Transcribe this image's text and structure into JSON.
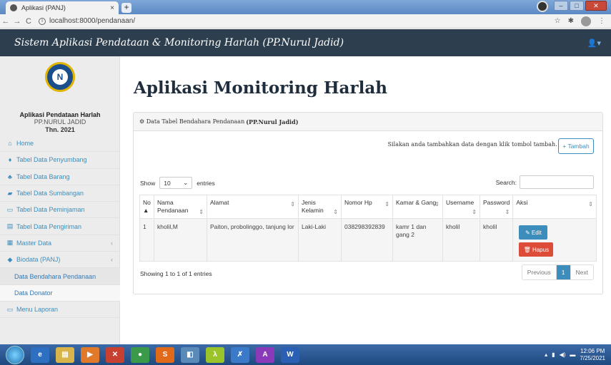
{
  "browser": {
    "tab_title": "Aplikasi (PANJ)",
    "tab_close": "×",
    "new_tab": "+",
    "url": "localhost:8000/pendanaan/"
  },
  "app": {
    "title": "Sistem Aplikasi Pendataan & Monitoring Harlah (PP.Nurul Jadid)"
  },
  "sidebar": {
    "brand_line1": "Aplikasi Pendataan Harlah",
    "brand_line2": "PP.NURUL JADID",
    "brand_line3": "Thn. 2021",
    "items": [
      {
        "label": "Home",
        "icon": "home-icon",
        "glyph": "⌂"
      },
      {
        "label": "Tabel Data Penyumbang",
        "icon": "user-icon",
        "glyph": "♦"
      },
      {
        "label": "Tabel Data Barang",
        "icon": "cubes-icon",
        "glyph": "♣"
      },
      {
        "label": "Tabel Data Sumbangan",
        "icon": "book-icon",
        "glyph": "▰"
      },
      {
        "label": "Tabel Data Peminjaman",
        "icon": "laptop-icon",
        "glyph": "▭"
      },
      {
        "label": "Tabel Data Pengiriman",
        "icon": "list-icon",
        "glyph": "▤"
      },
      {
        "label": "Master Data",
        "icon": "table-icon",
        "glyph": "▦"
      },
      {
        "label": "Biodata (PANJ)",
        "icon": "circle-icon",
        "glyph": "◆"
      },
      {
        "label": "Data Bendahara Pendanaan"
      },
      {
        "label": "Data Donator"
      },
      {
        "label": "Menu Laporan",
        "icon": "laptop-icon",
        "glyph": "▭"
      }
    ]
  },
  "main": {
    "page_title": "Aplikasi Monitoring Harlah",
    "panel_title_prefix": "Data Tabel Bendahara Pendanaan",
    "panel_title_bold": "(PP.Nurul Jadid)",
    "hint": "Silakan anda tambahkan data dengan klik tombol tambah. →",
    "add_button": "+ Tambah",
    "show_label": "Show",
    "entries_value": "10",
    "entries_label": "entries",
    "search_label": "Search:",
    "columns": [
      "No",
      "Nama Pendanaan",
      "Alamat",
      "Jenis Kelamin",
      "Nomor Hp",
      "Kamar & Gang",
      "Username",
      "Password",
      "Aksi"
    ],
    "rows": [
      {
        "no": "1",
        "nama": "kholil,M",
        "alamat": "Paiton, probolinggo, tanjung lor",
        "jk": "Laki-Laki",
        "hp": "038298392839",
        "kamar": "kamr 1 dan gang 2",
        "user": "kholil",
        "pass": "kholil"
      }
    ],
    "edit_label": "✎ Edit",
    "delete_label": "🗑 Hapus",
    "info": "Showing 1 to 1 of 1 entries",
    "pager": {
      "prev": "Previous",
      "page": "1",
      "next": "Next"
    }
  },
  "taskbar": {
    "time": "12:06 PM",
    "date": "7/25/2021"
  },
  "colors": {
    "navbar": "#2d3e4e",
    "primary": "#3c8dbc",
    "danger": "#dd4b39",
    "sidebar": "#ececec"
  }
}
